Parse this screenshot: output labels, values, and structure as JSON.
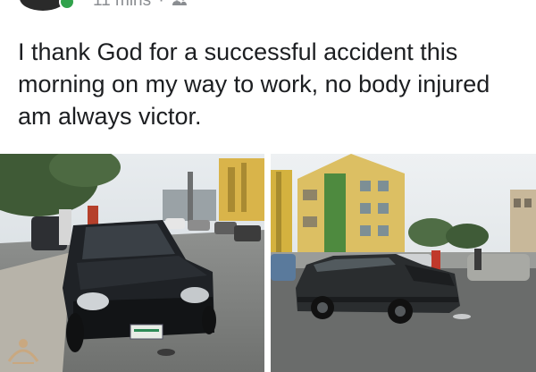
{
  "post": {
    "timestamp": "11 mins",
    "separator": "·",
    "audience_icon": "friends-icon",
    "text": "I thank God for a successful accident this morning on my way to work, no body injured am always victor."
  },
  "photos": {
    "left": {
      "plate_text": "",
      "description_icon": "car-front-photo"
    },
    "right": {
      "description_icon": "car-side-photo"
    }
  },
  "colors": {
    "online": "#31a24c",
    "meta_gray": "#8a8d91",
    "text": "#1c1e21"
  }
}
